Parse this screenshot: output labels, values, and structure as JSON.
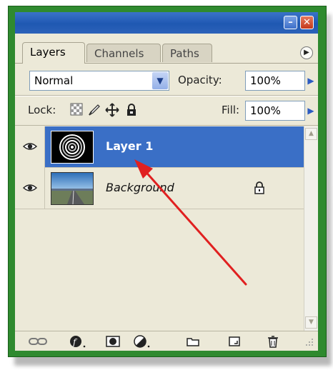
{
  "tabs": [
    {
      "label": "Layers",
      "active": true
    },
    {
      "label": "Channels",
      "active": false
    },
    {
      "label": "Paths",
      "active": false
    }
  ],
  "blend_mode": "Normal",
  "opacity": {
    "label": "Opacity:",
    "value": "100%"
  },
  "lock": {
    "label": "Lock:"
  },
  "fill": {
    "label": "Fill:",
    "value": "100%"
  },
  "layers": [
    {
      "name": "Layer 1",
      "visible": true,
      "selected": true,
      "thumbnail": "concentric-circles"
    },
    {
      "name": "Background",
      "visible": true,
      "selected": false,
      "locked": true,
      "thumbnail": "road-landscape"
    }
  ],
  "bottom_icons": [
    "link-layers-icon",
    "layer-style-icon",
    "layer-mask-icon",
    "adjustment-layer-icon",
    "new-group-icon",
    "new-layer-icon",
    "delete-layer-icon"
  ],
  "colors": {
    "selection": "#3a6fc6",
    "annotation_arrow": "#e02020",
    "frame": "#2f8a2f"
  }
}
